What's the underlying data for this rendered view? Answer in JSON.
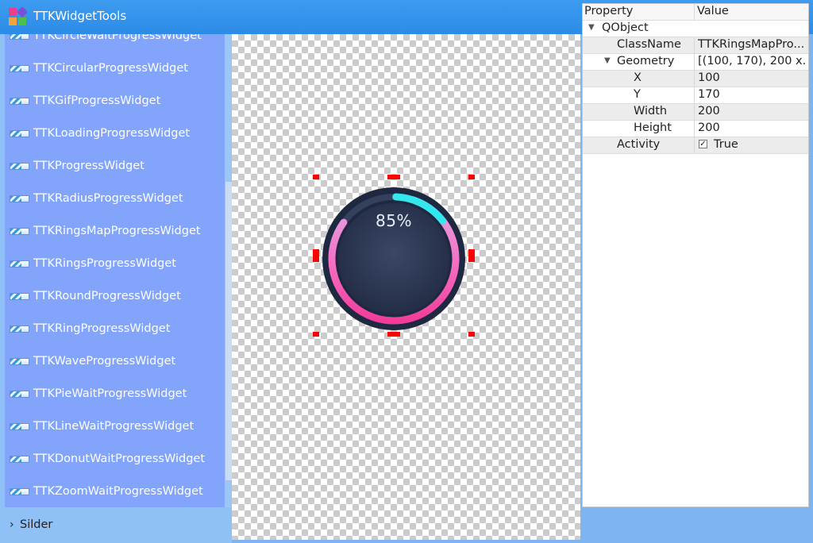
{
  "window": {
    "title": "TTKWidgetTools",
    "minimize_label": "—",
    "close_label": "✕",
    "logo_icon": "app-logo-icon"
  },
  "sidebar": {
    "items": [
      {
        "label": "TTKCircleWaitProgressWidget"
      },
      {
        "label": "TTKCircularProgressWidget"
      },
      {
        "label": "TTKGifProgressWidget"
      },
      {
        "label": "TTKLoadingProgressWidget"
      },
      {
        "label": "TTKProgressWidget"
      },
      {
        "label": "TTKRadiusProgressWidget"
      },
      {
        "label": "TTKRingsMapProgressWidget"
      },
      {
        "label": "TTKRingsProgressWidget"
      },
      {
        "label": "TTKRoundProgressWidget"
      },
      {
        "label": "TTKRingProgressWidget"
      },
      {
        "label": "TTKWaveProgressWidget"
      },
      {
        "label": "TTKPieWaitProgressWidget"
      },
      {
        "label": "TTKLineWaitProgressWidget"
      },
      {
        "label": "TTKDonutWaitProgressWidget"
      },
      {
        "label": "TTKZoomWaitProgressWidget"
      }
    ],
    "group": {
      "label": "Silder",
      "icon": "chevron-right-icon"
    }
  },
  "canvas": {
    "progress_text": "85%",
    "progress_value": 0.85,
    "colors": {
      "ring_pink": "#f23c9a",
      "ring_light": "#e2a6e8",
      "arc_cyan": "#34e6ee",
      "dial_dark": "#2c3650",
      "outer_dark": "#1e2841",
      "selection": "#ff0000"
    }
  },
  "properties": {
    "header": {
      "property": "Property",
      "value": "Value"
    },
    "section": "QObject",
    "rows": [
      {
        "name": "ClassName",
        "value": "TTKRingsMapPro..."
      },
      {
        "name": "Geometry",
        "value": "[(100, 170), 200 x..."
      },
      {
        "name": "X",
        "value": "100"
      },
      {
        "name": "Y",
        "value": "170"
      },
      {
        "name": "Width",
        "value": "200"
      },
      {
        "name": "Height",
        "value": "200"
      },
      {
        "name": "Activity",
        "value": "True"
      }
    ],
    "checkbox_mark": "✓"
  }
}
